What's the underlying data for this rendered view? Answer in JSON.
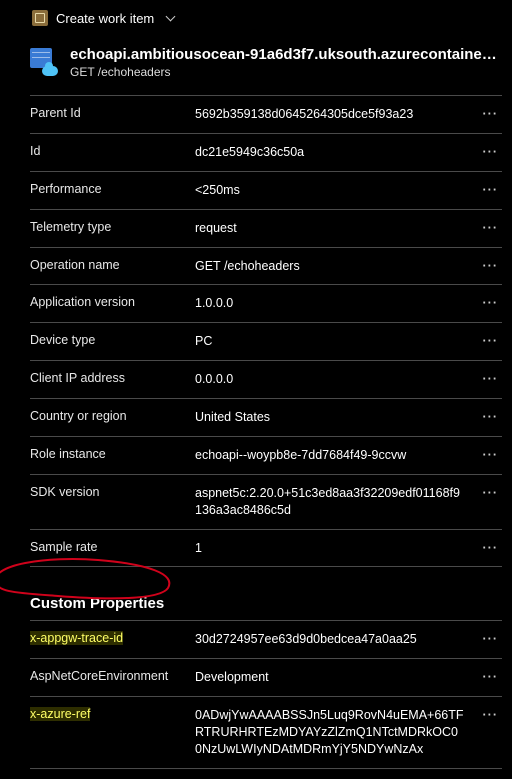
{
  "topbar": {
    "create_work_item": "Create work item"
  },
  "header": {
    "title": "echoapi.ambitiousocean-91a6d3f7.uksouth.azurecontainera...",
    "subtitle": "GET /echoheaders"
  },
  "props": [
    {
      "key": "Parent Id",
      "value": "5692b359138d0645264305dce5f93a23"
    },
    {
      "key": "Id",
      "value": "dc21e5949c36c50a"
    },
    {
      "key": "Performance",
      "value": "<250ms"
    },
    {
      "key": "Telemetry type",
      "value": "request"
    },
    {
      "key": "Operation name",
      "value": "GET /echoheaders"
    },
    {
      "key": "Application version",
      "value": "1.0.0.0"
    },
    {
      "key": "Device type",
      "value": "PC"
    },
    {
      "key": "Client IP address",
      "value": "0.0.0.0"
    },
    {
      "key": "Country or region",
      "value": "United States"
    },
    {
      "key": "Role instance",
      "value": "echoapi--woypb8e-7dd7684f49-9ccvw"
    },
    {
      "key": "SDK version",
      "value": "aspnet5c:2.20.0+51c3ed8aa3f32209edf01168f9136a3ac8486c5d"
    },
    {
      "key": "Sample rate",
      "value": "1"
    }
  ],
  "custom_title": "Custom Properties",
  "custom": [
    {
      "key": "x-appgw-trace-id",
      "value": "30d2724957ee63d9d0bedcea47a0aa25",
      "hl": true
    },
    {
      "key": "AspNetCoreEnvironment",
      "value": "Development",
      "hl": false
    },
    {
      "key": "x-azure-ref",
      "value": "0ADwjYwAAAABSSJn5Luq9RovN4uEMA+66TFRTRURHRTEzMDYAYzZlZmQ1NTctMDRkOC00NzUwLWIyNDAtMDRmYjY5NDYwNzAx",
      "hl": true
    }
  ]
}
